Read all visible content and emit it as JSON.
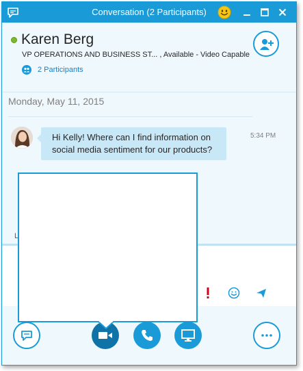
{
  "window": {
    "title": "Conversation (2 Participants)"
  },
  "contact": {
    "name": "Karen Berg",
    "details": "VP OPERATIONS AND BUSINESS ST...  ,  Available - Video Capable",
    "presence": "available",
    "participants_label": "2 Participants"
  },
  "conversation": {
    "date": "Monday, May 11, 2015",
    "messages": [
      {
        "text": "Hi Kelly! Where can I find information on social media sentiment for our products?",
        "time": "5:34 PM"
      }
    ],
    "partial_text": "L"
  },
  "toolbar": {
    "im": "chat-bubble-icon",
    "video": "video-camera-icon",
    "call": "phone-icon",
    "present": "monitor-icon",
    "more": "more-options-icon"
  },
  "colors": {
    "accent": "#1a9bd7",
    "accent_dark": "#0f73a8",
    "panel": "#eff8fd",
    "bubble": "#c8e8f8",
    "presence_available": "#7cb92e",
    "importance": "#d0021b"
  }
}
